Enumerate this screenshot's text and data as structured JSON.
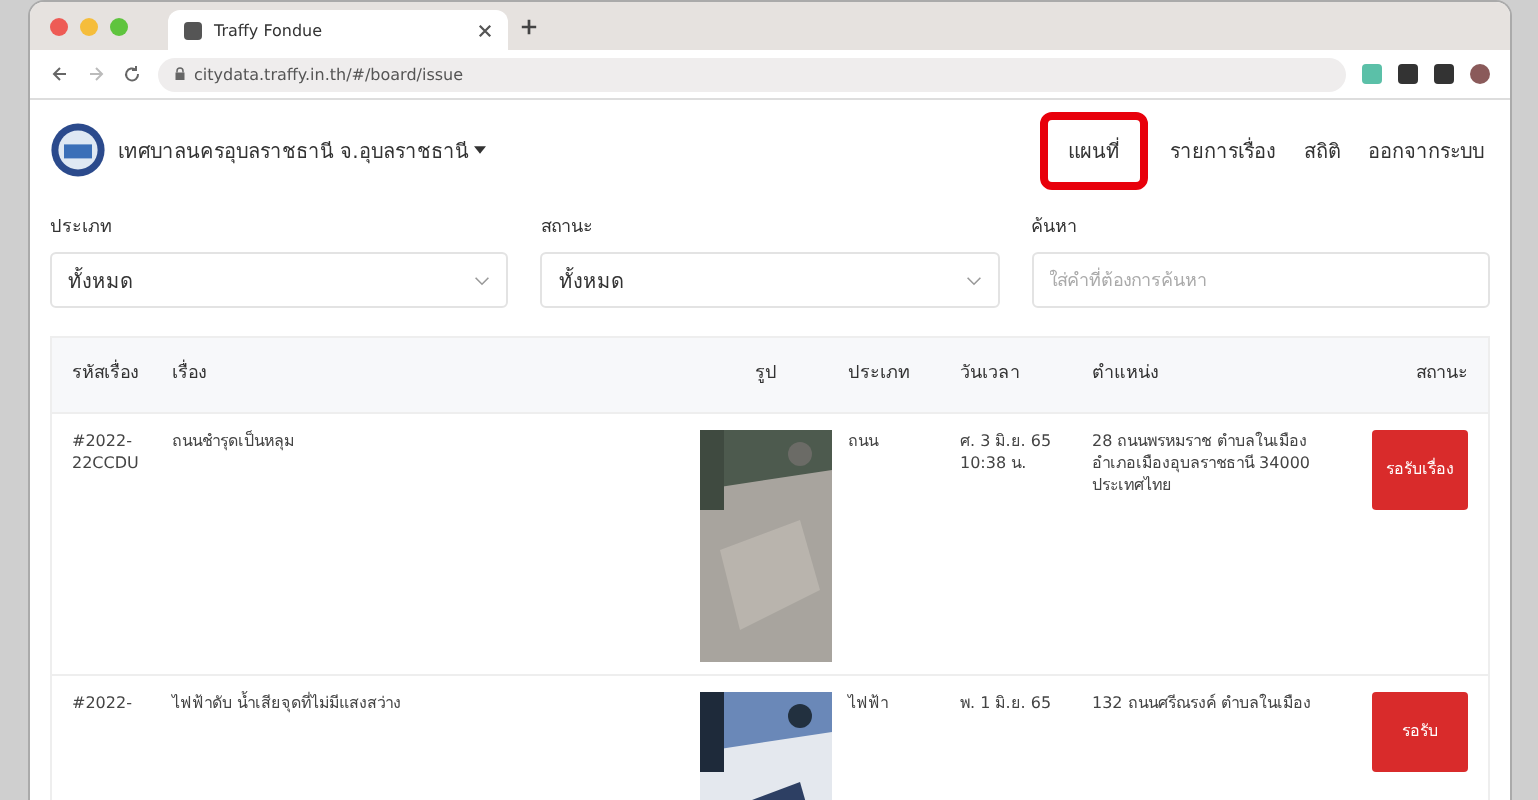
{
  "browser": {
    "tab_title": "Traffy Fondue",
    "url": "citydata.traffy.in.th/#/board/issue"
  },
  "header": {
    "org": "เทศบาลนครอุบลราชธานี จ.อุบลราชธานี",
    "nav": [
      {
        "label": "แผนที่",
        "highlighted": true
      },
      {
        "label": "รายการเรื่อง",
        "highlighted": false
      },
      {
        "label": "สถิติ",
        "highlighted": false
      },
      {
        "label": "ออกจากระบบ",
        "highlighted": false
      }
    ]
  },
  "filters": [
    {
      "kind": "select",
      "label": "ประเภท",
      "value": "ทั้งหมด"
    },
    {
      "kind": "select",
      "label": "สถานะ",
      "value": "ทั้งหมด"
    },
    {
      "kind": "text",
      "label": "ค้นหา",
      "placeholder": "ใส่คำที่ต้องการค้นหา"
    }
  ],
  "table": {
    "columns": [
      "รหัสเรื่อง",
      "เรื่อง",
      "รูป",
      "ประเภท",
      "วันเวลา",
      "ตำแหน่ง",
      "สถานะ"
    ],
    "rows": [
      {
        "id": "#2022-22CCDU",
        "title": "ถนนชำรุดเป็นหลุม",
        "type": "ถนน",
        "time": "ศ. 3 มิ.ย. 65 10:38 น.",
        "location": "28 ถนนพรหมราช ตำบลในเมือง อำเภอเมืองอุบลราชธานี 34000 ประเทศไทย",
        "status": "รอรับเรื่อง"
      },
      {
        "id": "#2022-",
        "title": "ไฟฟ้าดับ น้ำเสียจุดที่ไม่มีแสงสว่าง",
        "type": "ไฟฟ้า",
        "time": "พ. 1 มิ.ย. 65",
        "location": "132 ถนนศรีณรงค์ ตำบลในเมือง",
        "status": "รอรับ"
      }
    ]
  }
}
